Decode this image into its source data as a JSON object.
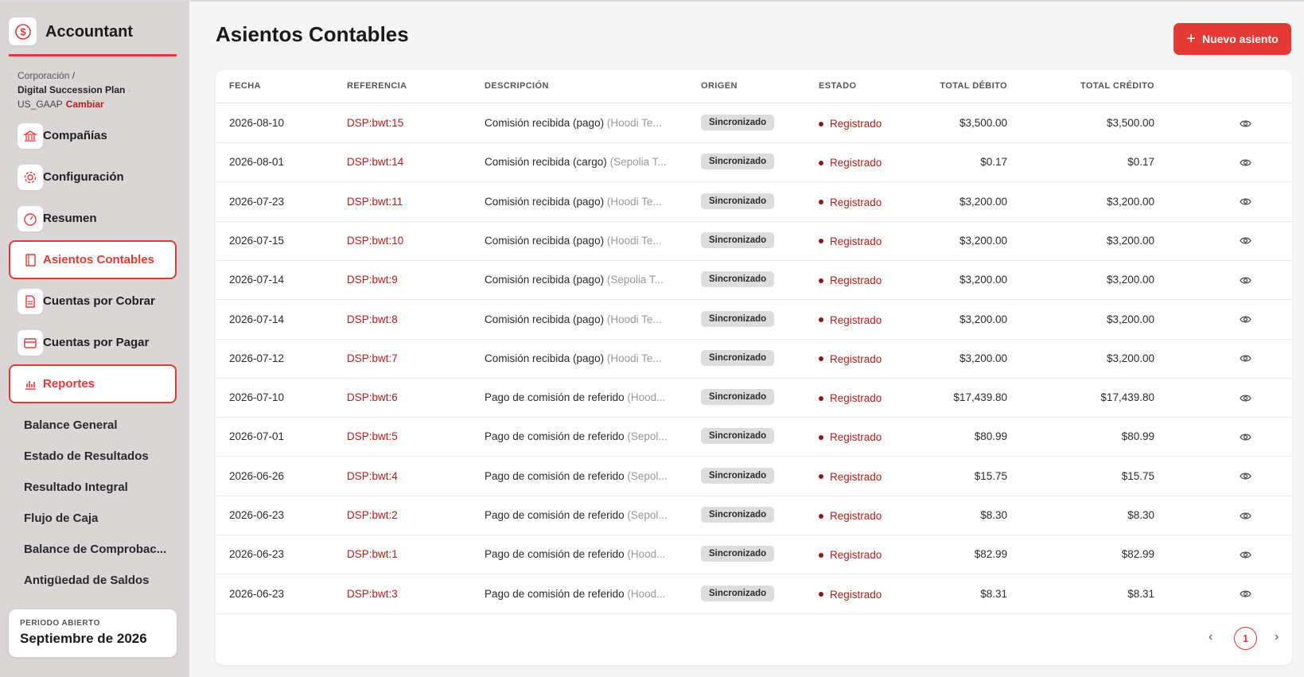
{
  "app": {
    "title": "Accountant"
  },
  "context": {
    "org": "Corporación",
    "separator": "/",
    "plan": "Digital Succession Plan",
    "dot": "·",
    "standard": "US_GAAP",
    "change": "Cambiar"
  },
  "sidebar": {
    "items": [
      {
        "label": "Compañías",
        "icon": "bank-icon"
      },
      {
        "label": "Configuración",
        "icon": "gear-icon"
      },
      {
        "label": "Resumen",
        "icon": "gauge-icon"
      },
      {
        "label": "Asientos Contables",
        "icon": "book-icon",
        "active": true
      },
      {
        "label": "Cuentas por Cobrar",
        "icon": "document-icon"
      },
      {
        "label": "Cuentas por Pagar",
        "icon": "card-icon"
      },
      {
        "label": "Reportes",
        "icon": "bar-chart-icon",
        "active": true
      }
    ],
    "reports": [
      "Balance General",
      "Estado de Resultados",
      "Resultado Integral",
      "Flujo de Caja",
      "Balance de Comprobac...",
      "Antigüedad de Saldos"
    ],
    "period": {
      "label": "PERIODO ABIERTO",
      "value": "Septiembre de 2026"
    }
  },
  "main": {
    "title": "Asientos Contables",
    "new_button": "Nuevo asiento",
    "columns": [
      "FECHA",
      "REFERENCIA",
      "DESCRIPCIÓN",
      "ORIGEN",
      "ESTADO",
      "TOTAL DÉBITO",
      "TOTAL CRÉDITO"
    ],
    "rows": [
      {
        "date": "2026-08-10",
        "ref": "DSP:bwt:15",
        "desc": "Comisión recibida (pago)",
        "hint": "(Hoodi Te...",
        "origin": "Sincronizado",
        "status": "Registrado",
        "debit": "$3,500.00",
        "credit": "$3,500.00"
      },
      {
        "date": "2026-08-01",
        "ref": "DSP:bwt:14",
        "desc": "Comisión recibida (cargo)",
        "hint": "(Sepolia T...",
        "origin": "Sincronizado",
        "status": "Registrado",
        "debit": "$0.17",
        "credit": "$0.17"
      },
      {
        "date": "2026-07-23",
        "ref": "DSP:bwt:11",
        "desc": "Comisión recibida (pago)",
        "hint": "(Hoodi Te...",
        "origin": "Sincronizado",
        "status": "Registrado",
        "debit": "$3,200.00",
        "credit": "$3,200.00"
      },
      {
        "date": "2026-07-15",
        "ref": "DSP:bwt:10",
        "desc": "Comisión recibida (pago)",
        "hint": "(Hoodi Te...",
        "origin": "Sincronizado",
        "status": "Registrado",
        "debit": "$3,200.00",
        "credit": "$3,200.00"
      },
      {
        "date": "2026-07-14",
        "ref": "DSP:bwt:9",
        "desc": "Comisión recibida (pago)",
        "hint": "(Sepolia T...",
        "origin": "Sincronizado",
        "status": "Registrado",
        "debit": "$3,200.00",
        "credit": "$3,200.00"
      },
      {
        "date": "2026-07-14",
        "ref": "DSP:bwt:8",
        "desc": "Comisión recibida (pago)",
        "hint": "(Hoodi Te...",
        "origin": "Sincronizado",
        "status": "Registrado",
        "debit": "$3,200.00",
        "credit": "$3,200.00"
      },
      {
        "date": "2026-07-12",
        "ref": "DSP:bwt:7",
        "desc": "Comisión recibida (pago)",
        "hint": "(Hoodi Te...",
        "origin": "Sincronizado",
        "status": "Registrado",
        "debit": "$3,200.00",
        "credit": "$3,200.00"
      },
      {
        "date": "2026-07-10",
        "ref": "DSP:bwt:6",
        "desc": "Pago de comisión de referido",
        "hint": "(Hood...",
        "origin": "Sincronizado",
        "status": "Registrado",
        "debit": "$17,439.80",
        "credit": "$17,439.80"
      },
      {
        "date": "2026-07-01",
        "ref": "DSP:bwt:5",
        "desc": "Pago de comisión de referido",
        "hint": "(Sepol...",
        "origin": "Sincronizado",
        "status": "Registrado",
        "debit": "$80.99",
        "credit": "$80.99"
      },
      {
        "date": "2026-06-26",
        "ref": "DSP:bwt:4",
        "desc": "Pago de comisión de referido",
        "hint": "(Sepol...",
        "origin": "Sincronizado",
        "status": "Registrado",
        "debit": "$15.75",
        "credit": "$15.75"
      },
      {
        "date": "2026-06-23",
        "ref": "DSP:bwt:2",
        "desc": "Pago de comisión de referido",
        "hint": "(Sepol...",
        "origin": "Sincronizado",
        "status": "Registrado",
        "debit": "$8.30",
        "credit": "$8.30"
      },
      {
        "date": "2026-06-23",
        "ref": "DSP:bwt:1",
        "desc": "Pago de comisión de referido",
        "hint": "(Hood...",
        "origin": "Sincronizado",
        "status": "Registrado",
        "debit": "$82.99",
        "credit": "$82.99"
      },
      {
        "date": "2026-06-23",
        "ref": "DSP:bwt:3",
        "desc": "Pago de comisión de referido",
        "hint": "(Hood...",
        "origin": "Sincronizado",
        "status": "Registrado",
        "debit": "$8.31",
        "credit": "$8.31"
      }
    ],
    "pagination": {
      "prev": "‹",
      "page": "1",
      "next": "›"
    }
  },
  "colors": {
    "accent": "#e53935",
    "link": "#b71c1c",
    "sidebar_bg": "#dbd6d6",
    "badge_bg": "#dddddd"
  }
}
